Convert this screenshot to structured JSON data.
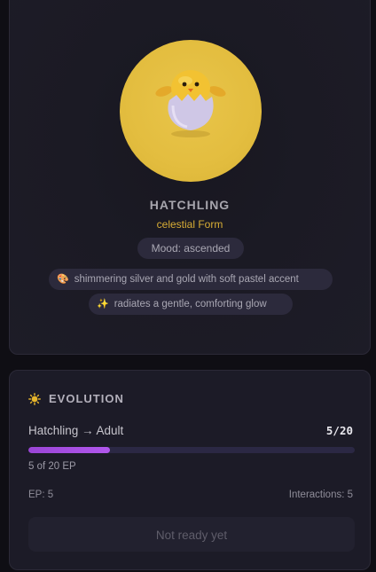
{
  "pet": {
    "stage": "HATCHLING",
    "form": "celestial Form",
    "mood": "Mood: ascended",
    "traits": [
      {
        "icon": "palette-emoji",
        "glyph": "🎨",
        "text": "shimmering silver and gold with soft pastel accent"
      },
      {
        "icon": "sparkles-emoji",
        "glyph": "✨",
        "text": "radiates a gentle, comforting glow"
      }
    ],
    "avatar_icon": "hatching-chick-icon",
    "avatar_color": "#e3bd3f"
  },
  "evolution": {
    "title": "EVOLUTION",
    "icon": "sun-icon",
    "progress_label": "Hatchling → Adult",
    "progress_count": "5/20",
    "progress_fraction": 0.25,
    "ep_text": "5 of 20 EP",
    "ep_stat": "EP: 5",
    "interactions_stat": "Interactions: 5",
    "button_label": "Not ready yet",
    "accent": "#a84fe4"
  }
}
